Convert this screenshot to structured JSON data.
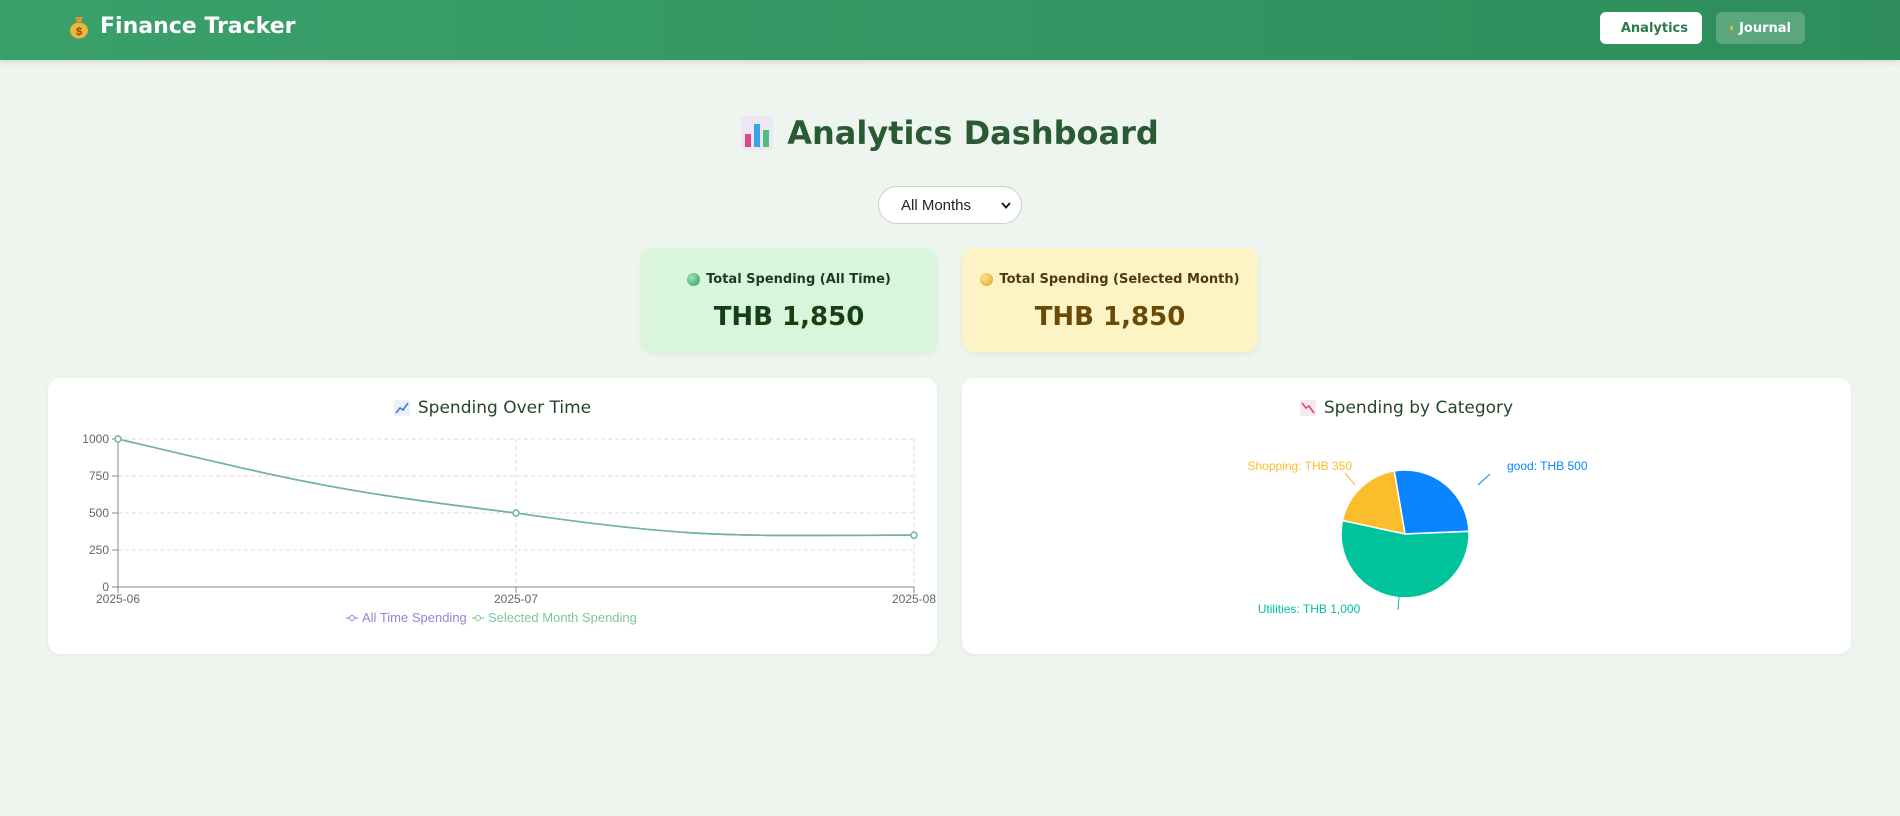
{
  "app": {
    "title": "Finance Tracker",
    "icon": "money-bag-icon"
  },
  "nav": {
    "analytics_label": "Analytics",
    "analytics_icon": "bar-chart-icon",
    "journal_label": "Journal",
    "journal_icon": "notebook-icon"
  },
  "page": {
    "title": "Analytics Dashboard",
    "icon": "bar-chart-icon"
  },
  "filter": {
    "selected": "All Months"
  },
  "stats": [
    {
      "label": "Total Spending (All Time)",
      "value": "THB 1,850",
      "icon": "green-circle-icon"
    },
    {
      "label": "Total Spending (Selected Month)",
      "value": "THB 1,850",
      "icon": "yellow-circle-icon"
    }
  ],
  "colors": {
    "header": "#2e8d5b",
    "line_series": "#71b78f",
    "legend_all_time": "#8a8ad8",
    "legend_selected": "#7cc79a",
    "pie_good": "#0a84ff",
    "pie_shopping": "#fbbd2c",
    "pie_utilities": "#00c29b"
  },
  "charts": {
    "line_title": "Spending Over Time",
    "line_icon": "chart-increasing-icon",
    "pie_title": "Spending by Category",
    "pie_icon": "chart-decreasing-icon"
  },
  "chart_data": [
    {
      "type": "line",
      "x": [
        "2025-06",
        "2025-07",
        "2025-08"
      ],
      "series": [
        {
          "name": "All Time Spending",
          "values": [
            1000,
            500,
            350
          ]
        },
        {
          "name": "Selected Month Spending",
          "values": [
            1000,
            500,
            350
          ]
        }
      ],
      "y_ticks": [
        0,
        250,
        500,
        750,
        1000
      ],
      "ylim": [
        0,
        1000
      ],
      "grid": true,
      "legend": "bottom"
    },
    {
      "type": "pie",
      "categories": [
        "good",
        "Utilities",
        "Shopping"
      ],
      "values": [
        500,
        1000,
        350
      ],
      "labels": [
        "good: THB 500",
        "Utilities: THB 1,000",
        "Shopping: THB 350"
      ],
      "colors": [
        "#0a84ff",
        "#00c29b",
        "#fbbd2c"
      ]
    }
  ]
}
